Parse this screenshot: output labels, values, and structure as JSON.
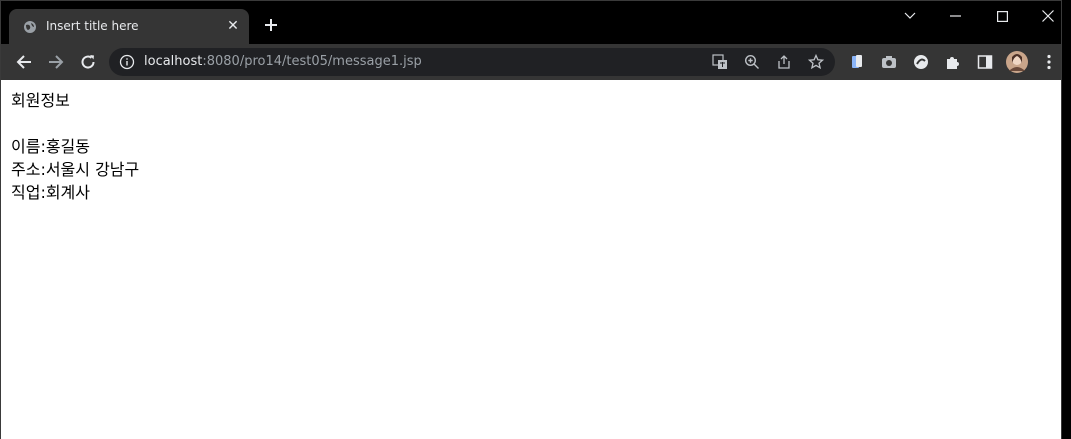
{
  "browser": {
    "tab": {
      "title": "Insert title here",
      "favicon": "globe-icon",
      "close_label": "✕"
    },
    "new_tab_label": "+",
    "address": {
      "host": "localhost",
      "path": ":8080/pro14/test05/message1.jsp"
    },
    "nav": [
      "back-icon",
      "forward-icon",
      "reload-icon"
    ],
    "omnibox_icons": [
      "translate-icon",
      "zoom-icon",
      "share-icon",
      "bookmark-star-icon"
    ],
    "extension_icons": [
      "bookmark-ext-icon",
      "camera-ext-icon",
      "circle-ext-icon",
      "puzzle-icon",
      "side-panel-icon",
      "profile-avatar",
      "menu-dots-icon"
    ],
    "window_controls": [
      "chevron-down-icon",
      "minimize-icon",
      "maximize-icon",
      "close-icon"
    ]
  },
  "page": {
    "heading": "회원정보",
    "lines": [
      "이름:홍길동",
      "주소:서울시 강남구",
      "직업:회계사"
    ]
  },
  "colors": {
    "frame": "#000000",
    "toolbar": "#353535",
    "omnibox": "#202124",
    "text_light": "#e8eaed",
    "text_dim": "#9aa0a6"
  }
}
